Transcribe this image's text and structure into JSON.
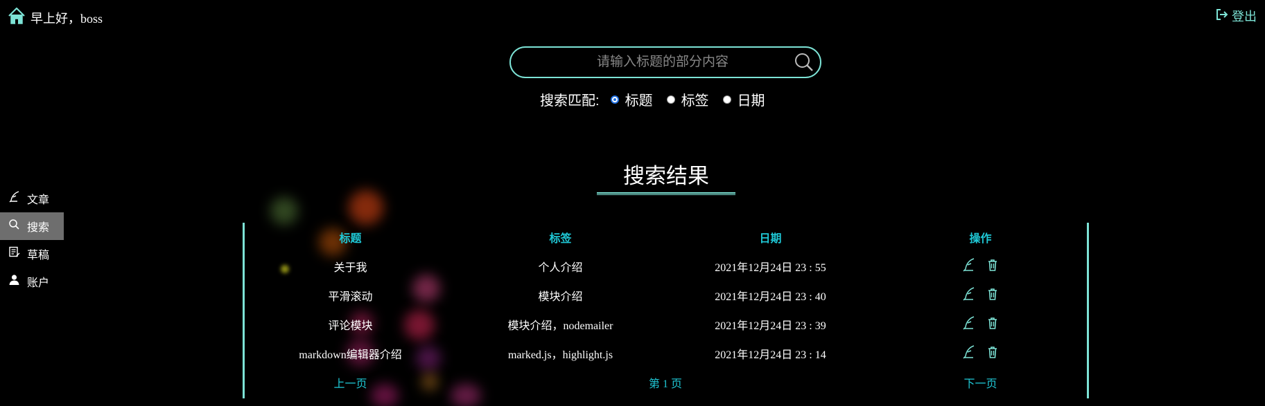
{
  "header": {
    "greeting": "早上好，boss",
    "logout_label": "登出"
  },
  "search": {
    "placeholder": "请输入标题的部分内容",
    "value": "",
    "match_label": "搜索匹配:",
    "options": [
      {
        "label": "标题",
        "checked": true
      },
      {
        "label": "标签",
        "checked": false
      },
      {
        "label": "日期",
        "checked": false
      }
    ]
  },
  "sidebar": {
    "items": [
      {
        "label": "文章",
        "icon": "quill-icon",
        "active": false
      },
      {
        "label": "搜索",
        "icon": "search-icon",
        "active": true
      },
      {
        "label": "草稿",
        "icon": "draft-icon",
        "active": false
      },
      {
        "label": "账户",
        "icon": "user-icon",
        "active": false
      }
    ]
  },
  "results": {
    "title": "搜索结果",
    "columns": [
      "标题",
      "标签",
      "日期",
      "操作"
    ],
    "rows": [
      {
        "title": "关于我",
        "tags": "个人介绍",
        "date": "2021年12月24日 23 : 55"
      },
      {
        "title": "平滑滚动",
        "tags": "模块介绍",
        "date": "2021年12月24日 23 : 40"
      },
      {
        "title": "评论模块",
        "tags": "模块介绍，nodemailer",
        "date": "2021年12月24日 23 : 39"
      },
      {
        "title": "markdown编辑器介绍",
        "tags": "marked.js，highlight.js",
        "date": "2021年12月24日 23 : 14"
      }
    ],
    "pager": {
      "prev": "上一页",
      "current": "第 1 页",
      "next": "下一页"
    }
  },
  "colors": {
    "accent": "#7de3d6",
    "table_link": "#1fc8d6",
    "background": "#000000",
    "active_sidebar": "#6e6e6e"
  }
}
